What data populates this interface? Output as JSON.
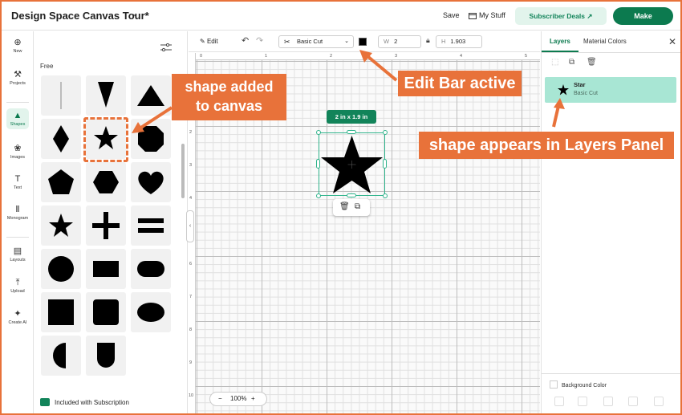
{
  "header": {
    "title": "Design Space Canvas Tour*",
    "save": "Save",
    "my_stuff": "My Stuff",
    "subscriber_deals": "Subscriber Deals",
    "make": "Make"
  },
  "rail": {
    "items": [
      {
        "label": "New",
        "icon": "plus-circle-icon"
      },
      {
        "label": "Projects",
        "icon": "projects-icon"
      },
      {
        "label": "Shapes",
        "icon": "shapes-icon",
        "active": true
      },
      {
        "label": "Images",
        "icon": "images-icon"
      },
      {
        "label": "Text",
        "icon": "text-icon"
      },
      {
        "label": "Monogram",
        "icon": "monogram-icon"
      },
      {
        "label": "Layouts",
        "icon": "layouts-icon"
      },
      {
        "label": "Upload",
        "icon": "upload-icon"
      },
      {
        "label": "Create AI",
        "icon": "create-ai-icon"
      }
    ]
  },
  "shapes_panel": {
    "section_label": "Free",
    "shapes": [
      "line",
      "triangle-down",
      "triangle",
      "diamond",
      "star",
      "octagon",
      "pentagon",
      "hexagon",
      "heart",
      "star-5",
      "plus",
      "equals",
      "circle",
      "rectangle",
      "rounded-rectangle",
      "square",
      "rounded-square",
      "oval",
      "half-circle",
      "arch"
    ],
    "footer": "Included with Subscription"
  },
  "edit_bar": {
    "edit": "Edit",
    "operation": "Basic Cut",
    "color": "#000000",
    "w_label": "W",
    "w_value": "2",
    "h_label": "H",
    "h_value": "1.903"
  },
  "canvas": {
    "ruler_top": [
      "0",
      "1",
      "2",
      "3",
      "4",
      "5"
    ],
    "ruler_left": [
      "1",
      "2",
      "3",
      "4",
      "5",
      "6",
      "7",
      "8",
      "9",
      "10"
    ],
    "size_badge": "2 in x 1.9 in",
    "zoom": "100%"
  },
  "layers_panel": {
    "tab_layers": "Layers",
    "tab_material": "Material Colors",
    "layer_name": "Star",
    "layer_op": "Basic Cut",
    "background_color": "Background Color"
  },
  "annotations": {
    "shape_added": "shape added\nto canvas",
    "edit_bar_active": "Edit Bar active",
    "layers_panel": "shape appears in Layers Panel"
  }
}
